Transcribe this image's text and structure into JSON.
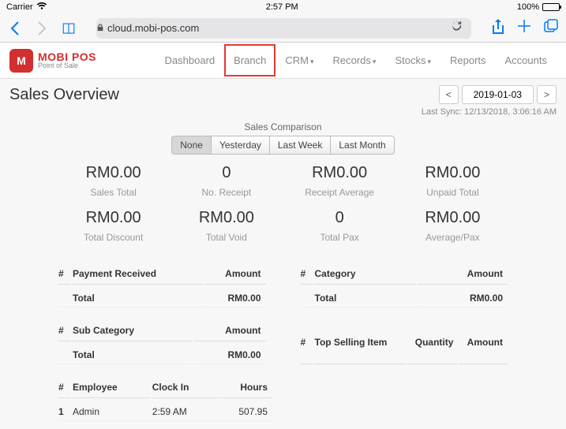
{
  "status": {
    "carrier": "Carrier",
    "time": "2:57 PM",
    "battery_pct": "100%"
  },
  "browser": {
    "url": "cloud.mobi-pos.com"
  },
  "logo": {
    "main": "MOBI POS",
    "sub": "Point of Sale",
    "m": "M"
  },
  "nav": {
    "dashboard": "Dashboard",
    "branch": "Branch",
    "crm": "CRM",
    "records": "Records",
    "stocks": "Stocks",
    "reports": "Reports",
    "accounts": "Accounts"
  },
  "page": {
    "title": "Sales Overview",
    "prev": "<",
    "next": ">",
    "date": "2019-01-03",
    "last_sync": "Last Sync: 12/13/2018, 3:06:16 AM"
  },
  "comparison": {
    "title": "Sales Comparison",
    "none": "None",
    "yesterday": "Yesterday",
    "last_week": "Last Week",
    "last_month": "Last Month"
  },
  "stats": {
    "r1c1": {
      "v": "RM0.00",
      "l": "Sales Total"
    },
    "r1c2": {
      "v": "0",
      "l": "No. Receipt"
    },
    "r1c3": {
      "v": "RM0.00",
      "l": "Receipt Average"
    },
    "r1c4": {
      "v": "RM0.00",
      "l": "Unpaid Total"
    },
    "r2c1": {
      "v": "RM0.00",
      "l": "Total Discount"
    },
    "r2c2": {
      "v": "RM0.00",
      "l": "Total Void"
    },
    "r2c3": {
      "v": "0",
      "l": "Total Pax"
    },
    "r2c4": {
      "v": "RM0.00",
      "l": "Average/Pax"
    }
  },
  "tables": {
    "idx": "#",
    "amount": "Amount",
    "total": "Total",
    "payment": {
      "h": "Payment Received",
      "total": "RM0.00"
    },
    "category": {
      "h": "Category",
      "total": "RM0.00"
    },
    "subcat": {
      "h": "Sub Category",
      "total": "RM0.00"
    },
    "topsell": {
      "h": "Top Selling Item",
      "qty": "Quantity"
    }
  },
  "employee": {
    "h": {
      "idx": "#",
      "emp": "Employee",
      "clock": "Clock In",
      "hours": "Hours"
    },
    "row": {
      "idx": "1",
      "emp": "Admin",
      "clock": "2:59 AM",
      "hours": "507.95"
    }
  }
}
